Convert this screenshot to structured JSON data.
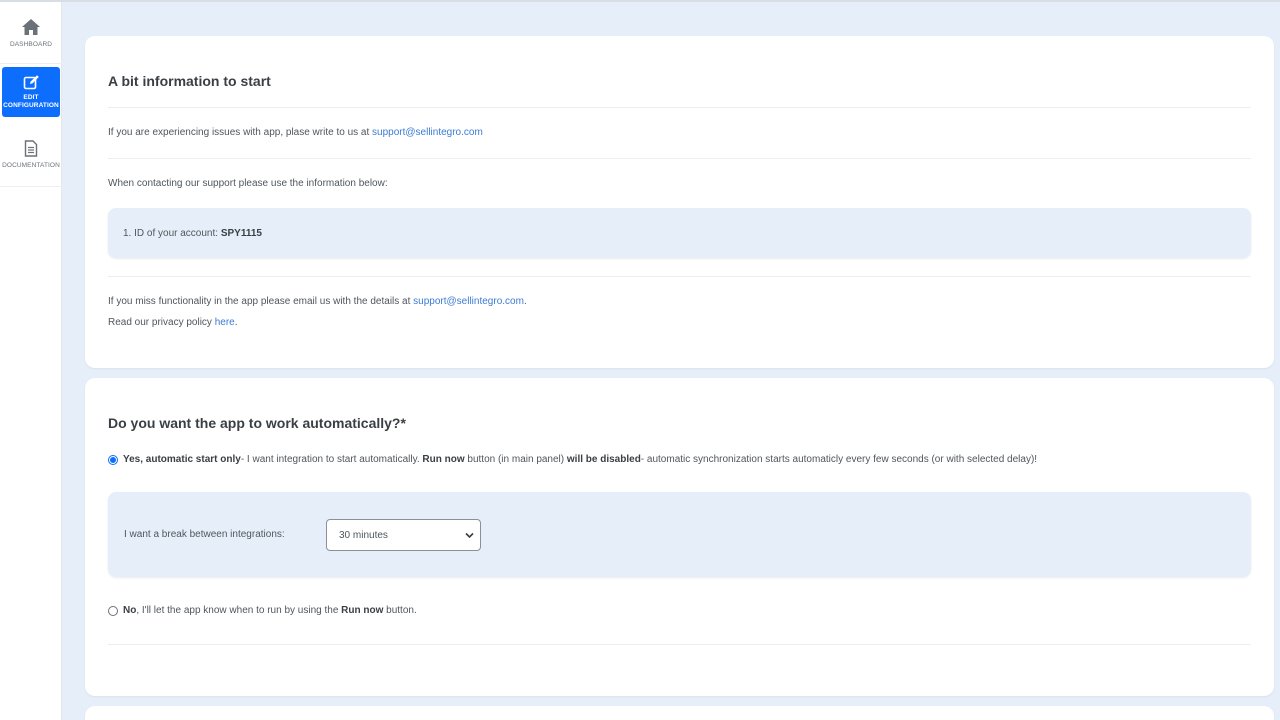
{
  "sidebar": {
    "items": [
      {
        "label": "DASHBOARD",
        "icon": "home-icon"
      },
      {
        "label": "EDIT CONFIGURATION",
        "icon": "edit-icon",
        "active": true
      },
      {
        "label": "DOCUMENTATION",
        "icon": "document-icon"
      }
    ],
    "accent_color": "#0d6efd"
  },
  "info_card": {
    "title": "A bit information to start",
    "issues_text": "If you are experiencing issues with app, plase write to us at ",
    "support_email": "support@sellintegro.com",
    "contact_text": "When contacting our support please use the information below:",
    "account_label": "1. ID of your account: ",
    "account_id": "SPY1115",
    "missing_text": "If you miss functionality in the app please email us with the details at ",
    "missing_email": "support@sellintegro.com",
    "missing_suffix": ".",
    "privacy_text": "Read our privacy policy ",
    "privacy_link": "here",
    "privacy_suffix": "."
  },
  "auto_card": {
    "title": "Do you want the app to work automatically?*",
    "option_yes": {
      "strong": "Yes, automatic start only",
      "text1": "- I want integration to start automatically. ",
      "strong2": "Run now",
      "text2": " button (in main panel) ",
      "strong3": "will be disabled",
      "text3": "- automatic synchronization starts automaticly every few seconds (or with selected delay)!",
      "checked": true
    },
    "break_label": "I want a break between integrations:",
    "break_value": "30 minutes",
    "option_no": {
      "strong": "No",
      "text1": ", I'll let the app know when to run by using the ",
      "strong2": "Run now",
      "text2": " button.",
      "checked": false
    }
  }
}
